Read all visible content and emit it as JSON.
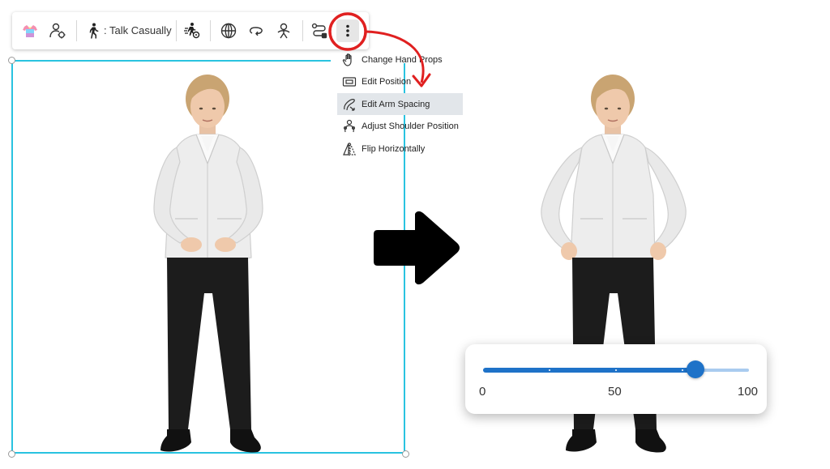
{
  "toolbar": {
    "items": [
      {
        "name": "outfit-color-button",
        "icon": "tshirt-color-icon"
      },
      {
        "name": "avatar-settings-button",
        "icon": "avatar-gear-icon"
      },
      {
        "name": "motion-button",
        "icon": "walking-person-icon"
      },
      {
        "name": "animation-settings-button",
        "icon": "running-person-gear-icon"
      },
      {
        "name": "globe-button",
        "icon": "globe-icon"
      },
      {
        "name": "rotate-button",
        "icon": "rotate-icon"
      },
      {
        "name": "pose-button",
        "icon": "person-pose-icon"
      },
      {
        "name": "path-button",
        "icon": "motion-path-icon"
      },
      {
        "name": "more-options-button",
        "icon": "vertical-ellipsis-icon"
      }
    ],
    "motion_label": ": Talk Casually"
  },
  "menu": {
    "items": [
      {
        "label": "Change Hand Props",
        "icon": "hand-icon",
        "active": false
      },
      {
        "label": "Edit Position",
        "icon": "position-rectangle-icon",
        "active": false
      },
      {
        "label": "Edit Arm Spacing",
        "icon": "arm-spacing-icon",
        "active": true
      },
      {
        "label": "Adjust Shoulder Position",
        "icon": "shoulder-icon",
        "active": false
      },
      {
        "label": "Flip Horizontally",
        "icon": "flip-horizontal-icon",
        "active": false
      }
    ]
  },
  "annotation": {
    "highlight_color": "#e02020",
    "arrow_color": "#e02020"
  },
  "slider": {
    "min_label": "0",
    "mid_label": "50",
    "max_label": "100",
    "value": 80,
    "min": 0,
    "max": 100,
    "accent": "#1e72c8",
    "track_color": "#a9cbef"
  },
  "colors": {
    "selection_frame": "#29c3e0",
    "menu_active_bg": "#e2e6ea"
  }
}
